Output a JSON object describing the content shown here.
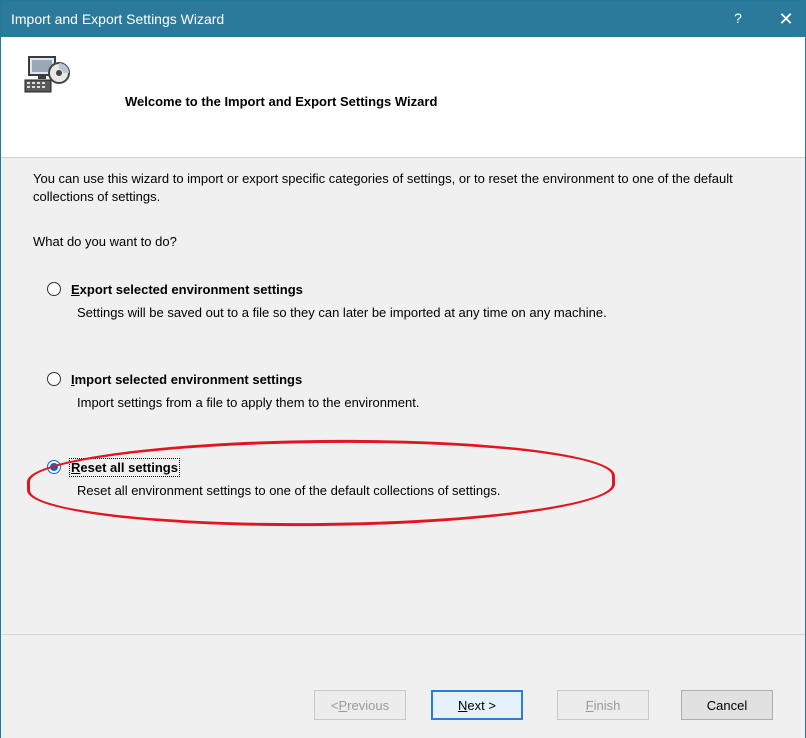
{
  "window": {
    "title": "Import and Export Settings Wizard",
    "help_glyph": "?",
    "close_glyph": "✕"
  },
  "header": {
    "title": "Welcome to the Import and Export Settings Wizard",
    "icon": "computer-settings-wizard-icon"
  },
  "content": {
    "intro": "You can use this wizard to import or export specific categories of settings, or to reset the environment to one of the default collections of settings.",
    "question": "What do you want to do?",
    "options": [
      {
        "label_first": "E",
        "label_rest": "xport selected environment settings",
        "description": "Settings will be saved out to a file so they can later be imported at any time on any machine.",
        "selected": false
      },
      {
        "label_first": "I",
        "label_rest": "mport selected environment settings",
        "description": "Import settings from a file to apply them to the environment.",
        "selected": false
      },
      {
        "label_first": "R",
        "label_rest": "eset all settings",
        "description": "Reset all environment settings to one of the default collections of settings.",
        "selected": true
      }
    ]
  },
  "footer": {
    "previous": {
      "prefix": "< ",
      "accel": "P",
      "rest": "revious",
      "enabled": false
    },
    "next": {
      "accel": "N",
      "rest": "ext >",
      "enabled": true
    },
    "finish": {
      "accel": "F",
      "rest": "inish",
      "enabled": false
    },
    "cancel": {
      "label": "Cancel",
      "enabled": true
    }
  },
  "colors": {
    "titlebar": "#2b7a9b",
    "annotation": "#e2161e",
    "radio_selected": "#0a64c8"
  }
}
